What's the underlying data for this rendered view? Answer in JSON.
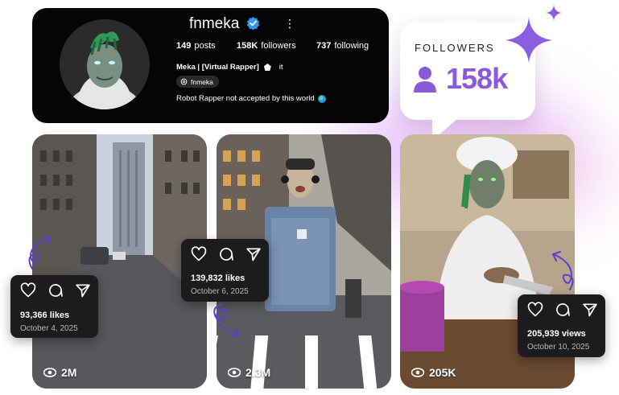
{
  "profile": {
    "username": "fnmeka",
    "stats": {
      "posts_value": "149",
      "posts_label": "posts",
      "followers_value": "158K",
      "followers_label": "followers",
      "following_value": "737",
      "following_label": "following"
    },
    "display_name": "Meka | [Virtual Rapper]",
    "name_suffix": "it",
    "threads_handle": "fnmeka",
    "bio": "Robot Rapper not accepted by this world"
  },
  "followers_badge": {
    "label": "FOLLOWERS",
    "count": "158k",
    "accent_color": "#8a5ad8"
  },
  "posts": [
    {
      "views": "2M"
    },
    {
      "views": "2.3M"
    },
    {
      "views": "205K"
    }
  ],
  "popups": [
    {
      "count": "93,366 likes",
      "date": "October 4, 2025"
    },
    {
      "count": "139,832 likes",
      "date": "October 6, 2025"
    },
    {
      "count": "205,939 views",
      "date": "October 10, 2025"
    }
  ],
  "icons": [
    "verified-badge-icon",
    "more-options-icon",
    "threads-icon",
    "globe-icon",
    "user-icon",
    "heart-icon",
    "comment-icon",
    "share-icon",
    "eye-icon",
    "sparkle-icon",
    "curly-arrow-icon"
  ]
}
